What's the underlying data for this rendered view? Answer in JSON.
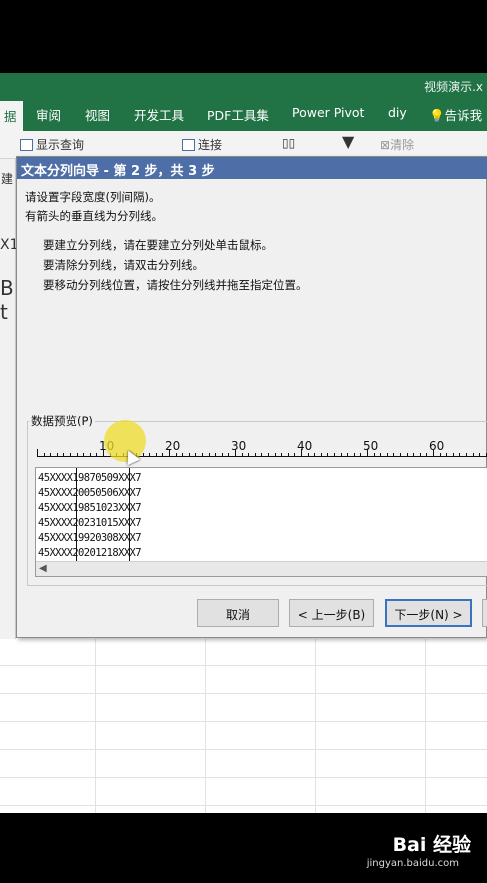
{
  "window": {
    "title": "视频演示.x"
  },
  "ribbon": {
    "tabs": [
      "据",
      "审阅",
      "视图",
      "开发工具",
      "PDF工具集",
      "Power Pivot",
      "diy",
      "告诉我"
    ],
    "items": {
      "show_query": "显示查询",
      "connections": "连接",
      "clear": "清除",
      "left_frag": "建"
    }
  },
  "sheet": {
    "fragments": {
      "cellref": "X1",
      "col_b": "B",
      "col_text": "t E"
    }
  },
  "dialog": {
    "title": "文本分列向导 - 第 2 步，共 3 步",
    "instructions": [
      "请设置字段宽度(列间隔)。",
      "有箭头的垂直线为分列线。"
    ],
    "tips": [
      "要建立分列线，请在要建立分列处单击鼠标。",
      "要清除分列线，请双击分列线。",
      "要移动分列线位置，请按住分列线并拖至指定位置。"
    ],
    "preview_label": "数据预览(P)",
    "ruler": [
      "10",
      "20",
      "30",
      "40",
      "50",
      "60"
    ],
    "preview_rows": [
      "45XXXX19870509XXX7",
      "45XXXX20050506XXX7",
      "45XXXX19851023XXX7",
      "45XXXX20231015XXX7",
      "45XXXX19920308XXX7",
      "45XXXX20201218XXX7"
    ],
    "buttons": {
      "cancel": "取消",
      "back": "< 上一步(B)",
      "next": "下一步(N) >"
    }
  },
  "watermark": {
    "brand": "Bai 经验",
    "url": "jingyan.baidu.com"
  }
}
